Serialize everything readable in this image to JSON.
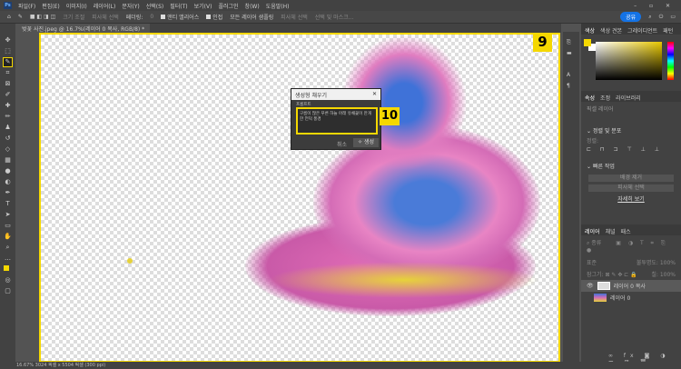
{
  "menu": [
    "파일(F)",
    "편집(E)",
    "이미지(I)",
    "레이어(L)",
    "문자(Y)",
    "선택(S)",
    "필터(T)",
    "보기(V)",
    "플러그인",
    "창(W)",
    "도움말(H)"
  ],
  "options": {
    "size_label": "크기 조절",
    "fit_label": "피사체 선택",
    "feather_label": "페더링:",
    "feather_value": "0",
    "antialias": "앤티 앨리어스",
    "contiguous": "인접",
    "all_layers": "모든 레이어 샘플링",
    "subject_button": "피사체 선택",
    "search_placeholder": "선택 및 마스크...",
    "share": "공유"
  },
  "document_tab": "벚꽃 사진.jpeg @ 16.7%(레이어 0 복사, RGB/8) *",
  "badges": {
    "nine": "9",
    "ten": "10"
  },
  "dialog": {
    "title": "생성형 채우기",
    "prompt_label": "프롬프트",
    "prompt_text": "구름이 많은 푸른 하늘 아래 유채꽃이 만개한 언덕 풍경",
    "cancel": "취소",
    "generate": "생성"
  },
  "color_panel": {
    "tabs": [
      "색상",
      "색상 견본",
      "그레이디언트",
      "패턴"
    ],
    "fg": "#f5d800",
    "bg": "#ffffff"
  },
  "properties": {
    "tabs": [
      "속성",
      "조정",
      "라이브러리"
    ],
    "type": "픽셀 레이어",
    "align_section": "정렬 및 분포",
    "align_label": "정렬:",
    "quick_section": "빠른 작업",
    "remove_bg": "배경 제거",
    "select_subject": "피사체 선택",
    "more": "자세히 보기"
  },
  "layers": {
    "tabs": [
      "레이어",
      "채널",
      "패스"
    ],
    "search": "종류",
    "blend": "표준",
    "opacity_label": "불투명도:",
    "opacity": "100%",
    "lock_label": "잠그기:",
    "fill_label": "칠:",
    "fill": "100%",
    "items": [
      {
        "name": "레이어 0 복사",
        "visible": true
      },
      {
        "name": "레이어 0",
        "visible": false
      }
    ]
  },
  "status": "16.67%  3024 픽셀 x 5504 픽셀 (300 ppi)"
}
